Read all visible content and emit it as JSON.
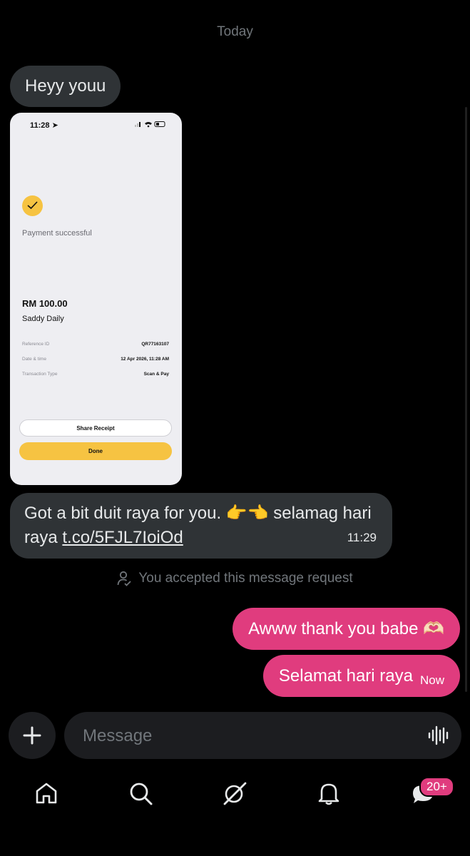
{
  "date_separator": "Today",
  "messages": {
    "greeting": "Heyy youu",
    "receipt": {
      "status_time": "11:28",
      "payment_status": "Payment successful",
      "amount": "RM 100.00",
      "merchant": "Saddy Daily",
      "rows": [
        {
          "label": "Reference ID",
          "value": "QR77163107"
        },
        {
          "label": "Date & time",
          "value": "12 Apr 2026, 11:28 AM"
        },
        {
          "label": "Transaction Type",
          "value": "Scan & Pay"
        }
      ],
      "share_label": "Share Receipt",
      "done_label": "Done"
    },
    "duit_raya": {
      "text": "Got a bit duit raya for you. 👉👈 selamag hari raya ",
      "link": "t.co/5FJL7IoiOd",
      "time": "11:29"
    },
    "accepted_notice": "You accepted this message request",
    "reply_thanks": "Awww thank you babe 🫶🏻",
    "reply_selamat": "Selamat hari raya",
    "reply_selamat_time": "Now"
  },
  "composer": {
    "placeholder": "Message"
  },
  "nav": {
    "items": [
      "home-icon",
      "search-icon",
      "grok-icon",
      "notifications-icon",
      "messages-icon"
    ],
    "messages_badge": "20+"
  },
  "colors": {
    "outgoing_bubble": "#e03c7e",
    "incoming_bubble": "#2f3336",
    "receipt_accent": "#f6c342"
  }
}
